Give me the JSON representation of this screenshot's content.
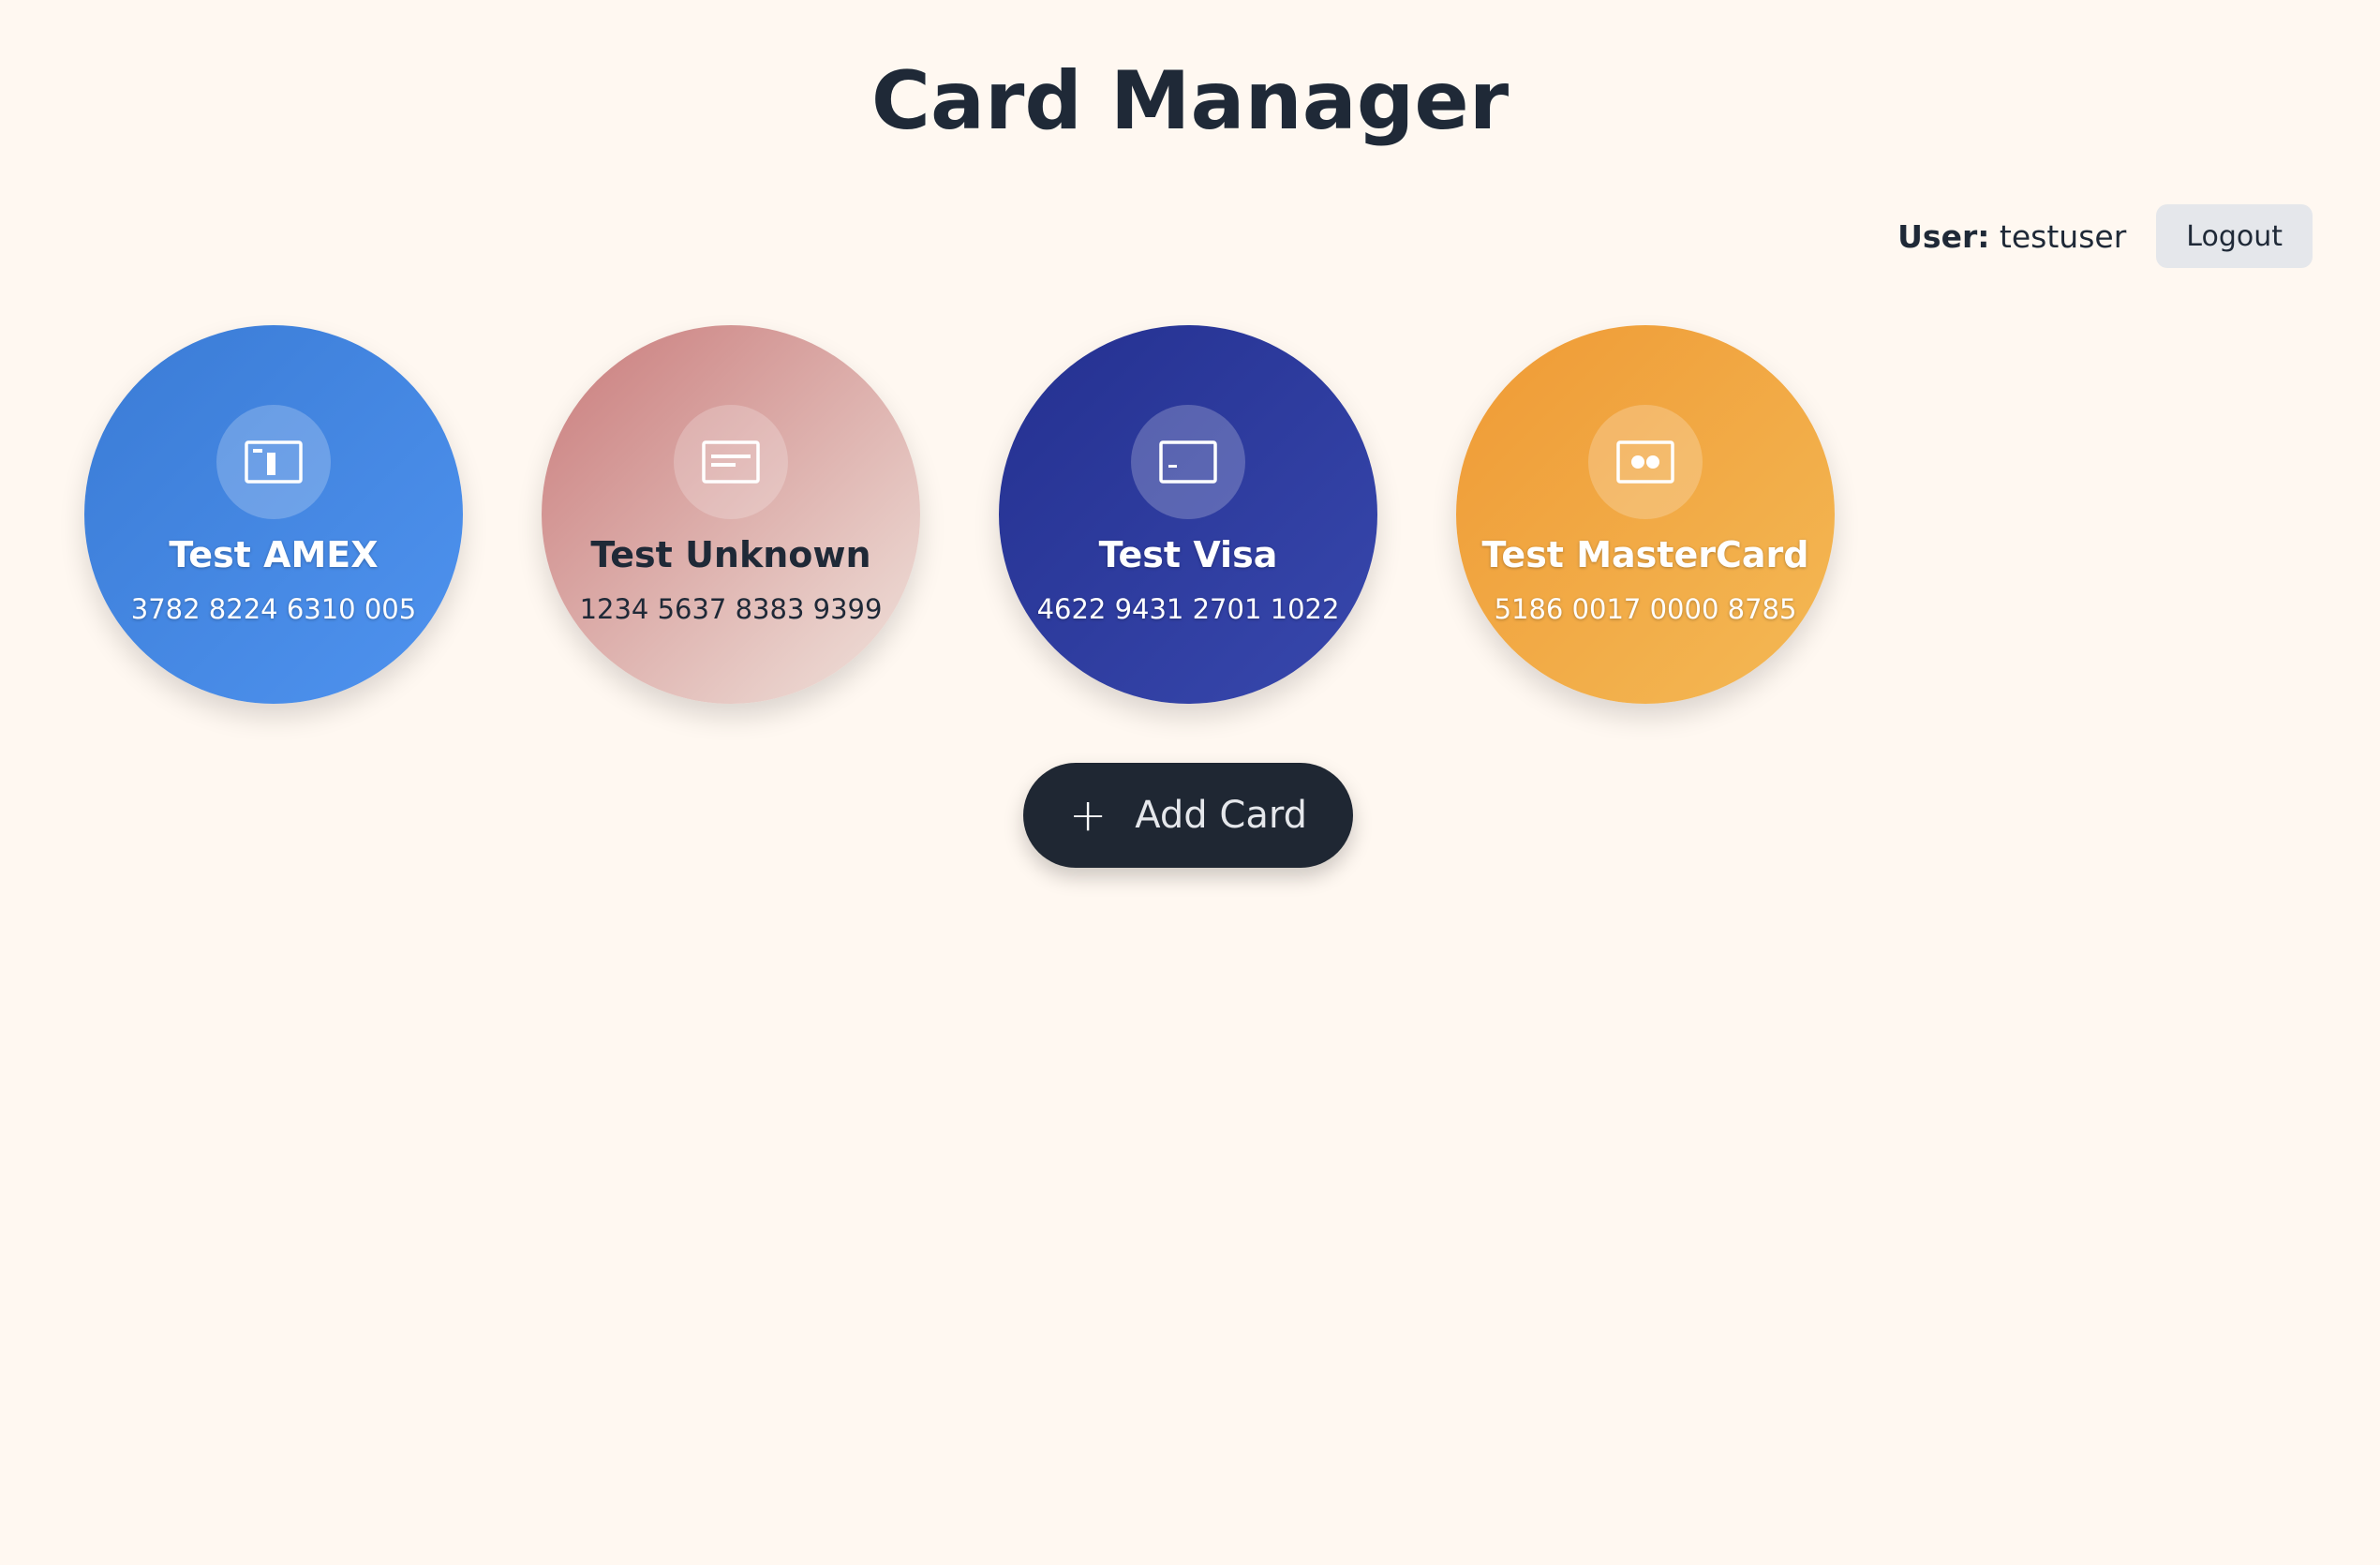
{
  "header": {
    "title": "Card Manager"
  },
  "user": {
    "label": "User:",
    "name": "testuser",
    "logout_label": "Logout"
  },
  "cards": [
    {
      "name": "Test AMEX",
      "number": "3782 8224 6310 005",
      "icon": "amex-card-icon",
      "gradient": [
        "#3a7bd5",
        "#4f93ef"
      ],
      "text_color": "#ffffff"
    },
    {
      "name": "Test Unknown",
      "number": "1234 5637 8383 9399",
      "icon": "generic-card-icon",
      "gradient": [
        "#c97b7b",
        "#f1e4dd"
      ],
      "text_color": "#1f2937"
    },
    {
      "name": "Test Visa",
      "number": "4622 9431 2701 1022",
      "icon": "visa-card-icon",
      "gradient": [
        "#243090",
        "#3848ad"
      ],
      "text_color": "#ffffff"
    },
    {
      "name": "Test MasterCard",
      "number": "5186 0017 0000 8785",
      "icon": "mastercard-card-icon",
      "gradient": [
        "#ef9a35",
        "#f4b955"
      ],
      "text_color": "#ffffff"
    }
  ],
  "actions": {
    "add_card_label": "Add Card"
  }
}
